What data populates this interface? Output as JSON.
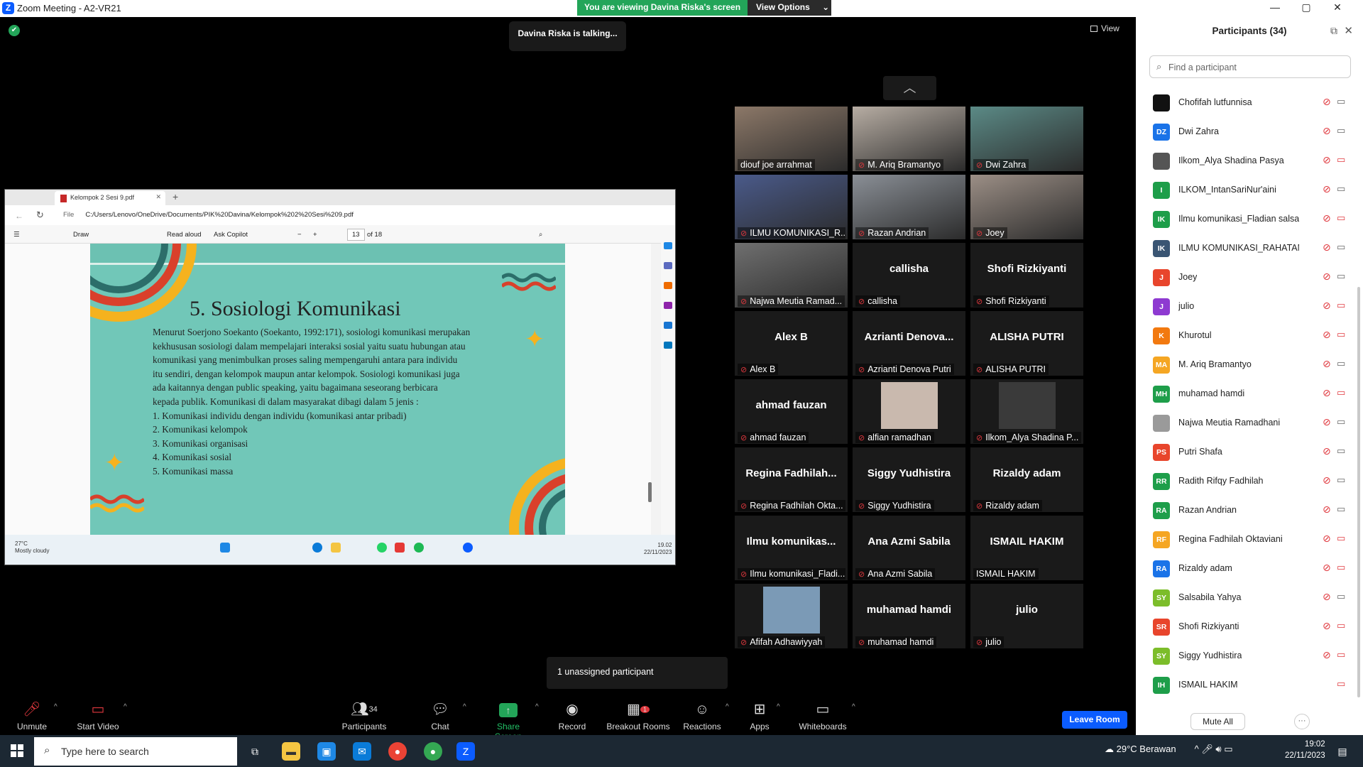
{
  "window": {
    "title": "Zoom Meeting - A2-VR21",
    "controls": [
      "—",
      "▢",
      "✕"
    ]
  },
  "banner": {
    "viewing": "You are viewing Davina Riska's screen",
    "view_options": "View Options",
    "chevron": "⌄"
  },
  "talking": "Davina Riska is talking...",
  "view_button": "View",
  "pdf": {
    "tab": "Kelompok 2 Sesi 9.pdf",
    "url_label": "File",
    "url": "C:/Users/Lenovo/OneDrive/Documents/PIK%20Davina/Kelompok%202%20Sesi%209.pdf",
    "draw": "Draw",
    "read_aloud": "Read aloud",
    "ask_copilot": "Ask Copilot",
    "page": "13",
    "of": "of 18",
    "slide_title": "5. Sosiologi Komunikasi",
    "slide_lines": [
      "Menurut Soerjono Soekanto (Soekanto, 1992:171), sosiologi komunikasi merupakan",
      "kekhususan sosiologi dalam mempelajari interaksi sosial yaitu suatu hubungan atau",
      "komunikasi yang menimbulkan proses saling mempengaruhi antara para individu",
      "itu sendiri, dengan kelompok maupun antar kelompok. Sosiologi komunikasi juga",
      "ada kaitannya dengan public speaking, yaitu bagaimana seseorang berbicara",
      "kepada publik. Komunikasi di dalam masyarakat dibagi dalam 5 jenis :",
      "1. Komunikasi individu dengan individu (komunikasi antar pribadi)",
      "2. Komunikasi kelompok",
      "3. Komunikasi organisasi",
      "4. Komunikasi sosial",
      "5. Komunikasi massa"
    ],
    "weather_temp": "27°C",
    "weather_desc": "Mostly cloudy",
    "time": "19.02",
    "date": "22/11/2023"
  },
  "tiles": [
    {
      "big": "",
      "name": "diouf joe arrahmat",
      "muted": false,
      "video": true,
      "color": "#8c7868"
    },
    {
      "big": "",
      "name": "M. Ariq Bramantyo",
      "muted": true,
      "video": true,
      "color": "#b7ada3"
    },
    {
      "big": "",
      "name": "Dwi Zahra",
      "muted": true,
      "video": true,
      "color": "#5b8a86"
    },
    {
      "big": "",
      "name": "ILMU KOMUNIKASI_R...",
      "muted": true,
      "video": true,
      "color": "#4a5a8a"
    },
    {
      "big": "",
      "name": "Razan Andrian",
      "muted": true,
      "video": true,
      "color": "#8a8f96"
    },
    {
      "big": "",
      "name": "Joey",
      "muted": true,
      "video": true,
      "color": "#9c8f86"
    },
    {
      "big": "",
      "name": "Najwa Meutia Ramad...",
      "muted": true,
      "video": true,
      "color": "#6f6f6f"
    },
    {
      "big": "callisha",
      "name": "callisha",
      "muted": true,
      "video": false
    },
    {
      "big": "Shofi Rizkiyanti",
      "name": "Shofi Rizkiyanti",
      "muted": true,
      "video": false
    },
    {
      "big": "Alex B",
      "name": "Alex B",
      "muted": true,
      "video": false
    },
    {
      "big": "Azrianti  Denova...",
      "name": "Azrianti Denova Putri",
      "muted": true,
      "video": false
    },
    {
      "big": "ALISHA PUTRI",
      "name": "ALISHA PUTRI",
      "muted": true,
      "video": false
    },
    {
      "big": "ahmad fauzan",
      "name": "ahmad fauzan",
      "muted": true,
      "video": false
    },
    {
      "big": "",
      "name": "alfian ramadhan",
      "muted": true,
      "video": false,
      "photo": "#c9b9ae"
    },
    {
      "big": "",
      "name": "Ilkom_Alya Shadina P...",
      "muted": true,
      "video": false,
      "photo": "#3a3a3a"
    },
    {
      "big": "Regina  Fadhilah...",
      "name": "Regina Fadhilah Okta...",
      "muted": true,
      "video": false
    },
    {
      "big": "Siggy Yudhistira",
      "name": "Siggy Yudhistira",
      "muted": true,
      "video": false
    },
    {
      "big": "Rizaldy adam",
      "name": "Rizaldy adam",
      "muted": true,
      "video": false
    },
    {
      "big": "Ilmu  komunikas...",
      "name": "Ilmu komunikasi_Fladi...",
      "muted": true,
      "video": false
    },
    {
      "big": "Ana Azmi Sabila",
      "name": "Ana Azmi Sabila",
      "muted": true,
      "video": false
    },
    {
      "big": "ISMAIL HAKIM",
      "name": "ISMAIL HAKIM",
      "muted": false,
      "video": false
    },
    {
      "big": "",
      "name": "Afifah Adhawiyyah",
      "muted": true,
      "video": false,
      "photo": "#7b9ab6"
    },
    {
      "big": "muhamad hamdi",
      "name": "muhamad hamdi",
      "muted": true,
      "video": false
    },
    {
      "big": "julio",
      "name": "julio",
      "muted": true,
      "video": false
    }
  ],
  "unassigned": "1 unassigned participant",
  "toolbar": {
    "unmute": "Unmute",
    "start_video": "Start Video",
    "participants": "Participants",
    "participant_count": "34",
    "chat": "Chat",
    "share": "Share Screen",
    "record": "Record",
    "breakout": "Breakout Rooms",
    "breakout_badge": "1",
    "reactions": "Reactions",
    "apps": "Apps",
    "whiteboards": "Whiteboards",
    "leave": "Leave Room"
  },
  "panel": {
    "title": "Participants (34)",
    "search_placeholder": "Find a participant",
    "mute_all": "Mute All",
    "more": "···",
    "people": [
      {
        "i": "",
        "n": "Chofifah lutfunnisa",
        "c": "#111111",
        "v": false
      },
      {
        "i": "DZ",
        "n": "Dwi Zahra",
        "c": "#1a73e8",
        "v": false
      },
      {
        "i": "",
        "n": "Ilkom_Alya Shadina Pasya",
        "c": "#555555",
        "v": true
      },
      {
        "i": "I",
        "n": "ILKOM_IntanSariNur'aini",
        "c": "#1e9e4a",
        "v": false
      },
      {
        "i": "IK",
        "n": "Ilmu komunikasi_Fladian salsabi...",
        "c": "#1e9e4a",
        "v": true
      },
      {
        "i": "IK",
        "n": "ILMU KOMUNIKASI_RAHATAMA...",
        "c": "#3a5573",
        "v": false
      },
      {
        "i": "J",
        "n": "Joey",
        "c": "#e8452c",
        "v": false
      },
      {
        "i": "J",
        "n": "julio",
        "c": "#8e3ad1",
        "v": true
      },
      {
        "i": "K",
        "n": "Khurotul",
        "c": "#f2790f",
        "v": true
      },
      {
        "i": "MA",
        "n": "M. Ariq Bramantyo",
        "c": "#f5a623",
        "v": false
      },
      {
        "i": "MH",
        "n": "muhamad hamdi",
        "c": "#1e9e4a",
        "v": true
      },
      {
        "i": "",
        "n": "Najwa Meutia Ramadhani",
        "c": "#9a9a9a",
        "v": false
      },
      {
        "i": "PS",
        "n": "Putri Shafa",
        "c": "#e8452c",
        "v": false
      },
      {
        "i": "RR",
        "n": "Radith Rifqy Fadhilah",
        "c": "#1e9e4a",
        "v": false
      },
      {
        "i": "RA",
        "n": "Razan Andrian",
        "c": "#1e9e4a",
        "v": false
      },
      {
        "i": "RF",
        "n": "Regina Fadhilah Oktaviani",
        "c": "#f5a623",
        "v": true
      },
      {
        "i": "RA",
        "n": "Rizaldy adam",
        "c": "#1a73e8",
        "v": true
      },
      {
        "i": "SY",
        "n": "Salsabila Yahya",
        "c": "#7cbd2a",
        "v": false
      },
      {
        "i": "SR",
        "n": "Shofi Rizkiyanti",
        "c": "#e8452c",
        "v": true
      },
      {
        "i": "SY",
        "n": "Siggy Yudhistira",
        "c": "#7cbd2a",
        "v": true
      },
      {
        "i": "IH",
        "n": "ISMAIL HAKIM",
        "c": "#1e9e4a",
        "v": true,
        "unmuted": true
      }
    ]
  },
  "taskbar": {
    "search": "Type here to search",
    "weather": "29°C  Berawan",
    "time": "19:02",
    "date": "22/11/2023"
  }
}
